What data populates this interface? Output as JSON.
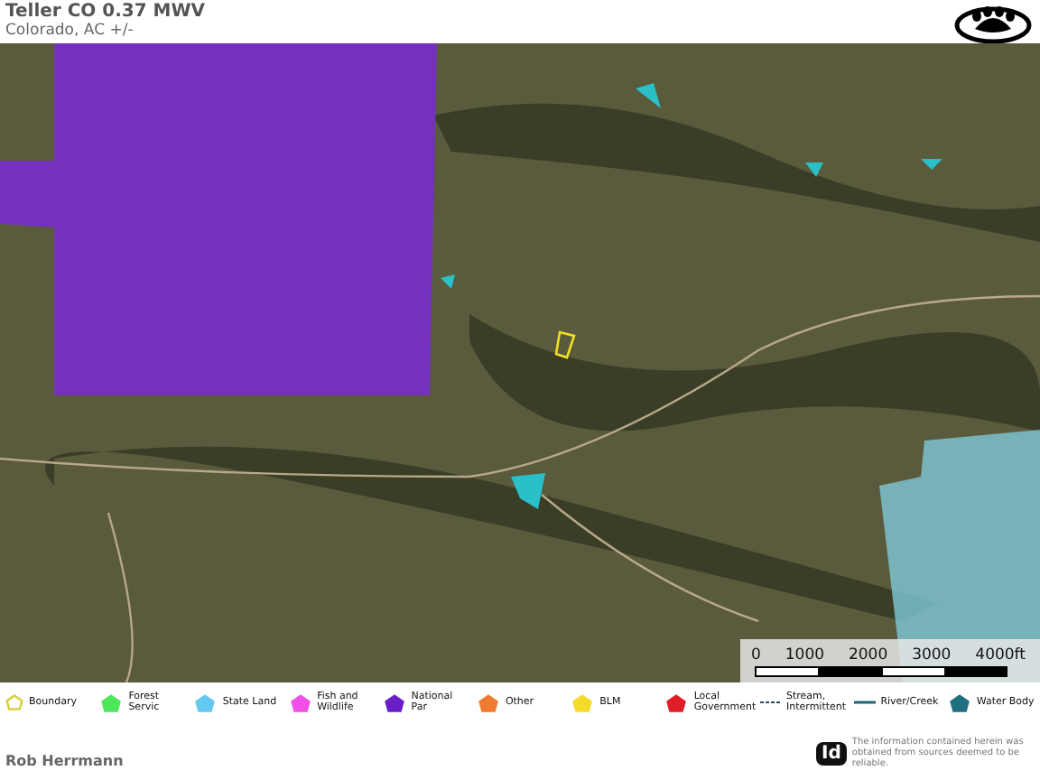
{
  "header": {
    "title": "Teller CO 0.37 MWV",
    "subtitle": "Colorado,  AC +/-"
  },
  "scale_bar": {
    "labels": [
      "0",
      "1000",
      "2000",
      "3000",
      "4000ft"
    ]
  },
  "legend": [
    {
      "kind": "boundary",
      "label": "Boundary",
      "color": "#d8d040"
    },
    {
      "kind": "area",
      "label": "Forest Servic",
      "color": "#4ee65a"
    },
    {
      "kind": "area",
      "label": "State Land",
      "color": "#64c8f0"
    },
    {
      "kind": "area",
      "label": "Fish and Wildlife",
      "color": "#f050e6"
    },
    {
      "kind": "area",
      "label": "National Par",
      "color": "#6a1ec8"
    },
    {
      "kind": "area",
      "label": "Other",
      "color": "#f07a30"
    },
    {
      "kind": "area",
      "label": "BLM",
      "color": "#f5dc28"
    },
    {
      "kind": "area",
      "label": "Local Government",
      "color": "#e01c28"
    },
    {
      "kind": "dashed",
      "label": "Stream, Intermittent",
      "color": "#2a4a5a"
    },
    {
      "kind": "line",
      "label": "River/Creek",
      "color": "#1e6478"
    },
    {
      "kind": "area",
      "label": "Water Body",
      "color": "#1e7080"
    }
  ],
  "footer": {
    "agent": "Rob Herrmann",
    "logo": "Id",
    "disclaimer": "The information contained herein was obtained from sources deemed to be reliable."
  }
}
